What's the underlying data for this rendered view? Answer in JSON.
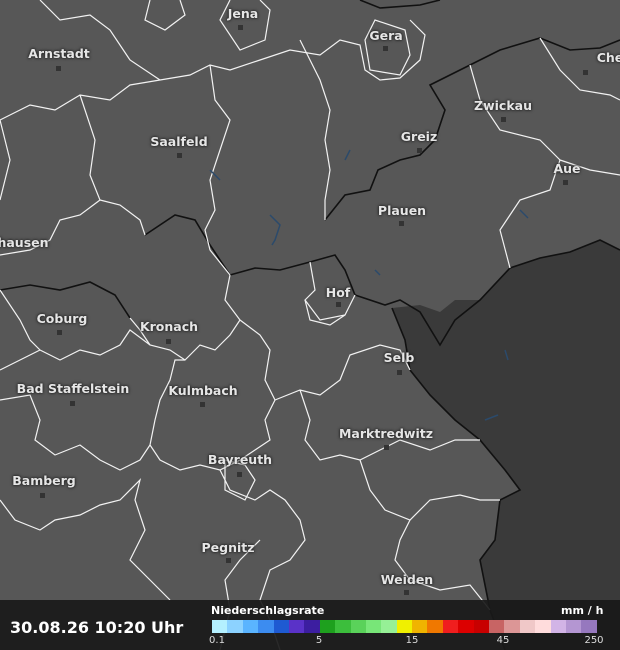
{
  "cities": [
    {
      "name": "Jena"
    },
    {
      "name": "Gera"
    },
    {
      "name": "Arnstadt"
    },
    {
      "name": "Che"
    },
    {
      "name": "Zwickau"
    },
    {
      "name": "Saalfeld"
    },
    {
      "name": "Greiz"
    },
    {
      "name": "Aue"
    },
    {
      "name": "Plauen"
    },
    {
      "name": "hausen"
    },
    {
      "name": "Hof"
    },
    {
      "name": "Coburg"
    },
    {
      "name": "Kronach"
    },
    {
      "name": "Selb"
    },
    {
      "name": "Bad Staffelstein"
    },
    {
      "name": "Kulmbach"
    },
    {
      "name": "Marktredwitz"
    },
    {
      "name": "Bayreuth"
    },
    {
      "name": "Bamberg"
    },
    {
      "name": "Pegnitz"
    },
    {
      "name": "Weiden"
    }
  ],
  "footer": {
    "timestamp": "30.08.26 10:20 Uhr",
    "legend_title": "Niederschlagsrate",
    "legend_unit": "mm / h",
    "legend_colors": [
      "#b4f0ff",
      "#8cd2ff",
      "#5ab4ff",
      "#3c8cf0",
      "#1e5ad2",
      "#5a32c8",
      "#3c1ea0",
      "#1ea01e",
      "#3cbe3c",
      "#5ad25a",
      "#78e678",
      "#96f096",
      "#f0f000",
      "#f0b400",
      "#f07800",
      "#f01e1e",
      "#dc0000",
      "#c80000",
      "#c86464",
      "#dc9696",
      "#f0c8c8",
      "#ffdcdc",
      "#d2b4e6",
      "#b496d2",
      "#9678be"
    ],
    "legend_ticks": [
      "0.1",
      "5",
      "15",
      "45",
      "250"
    ]
  }
}
